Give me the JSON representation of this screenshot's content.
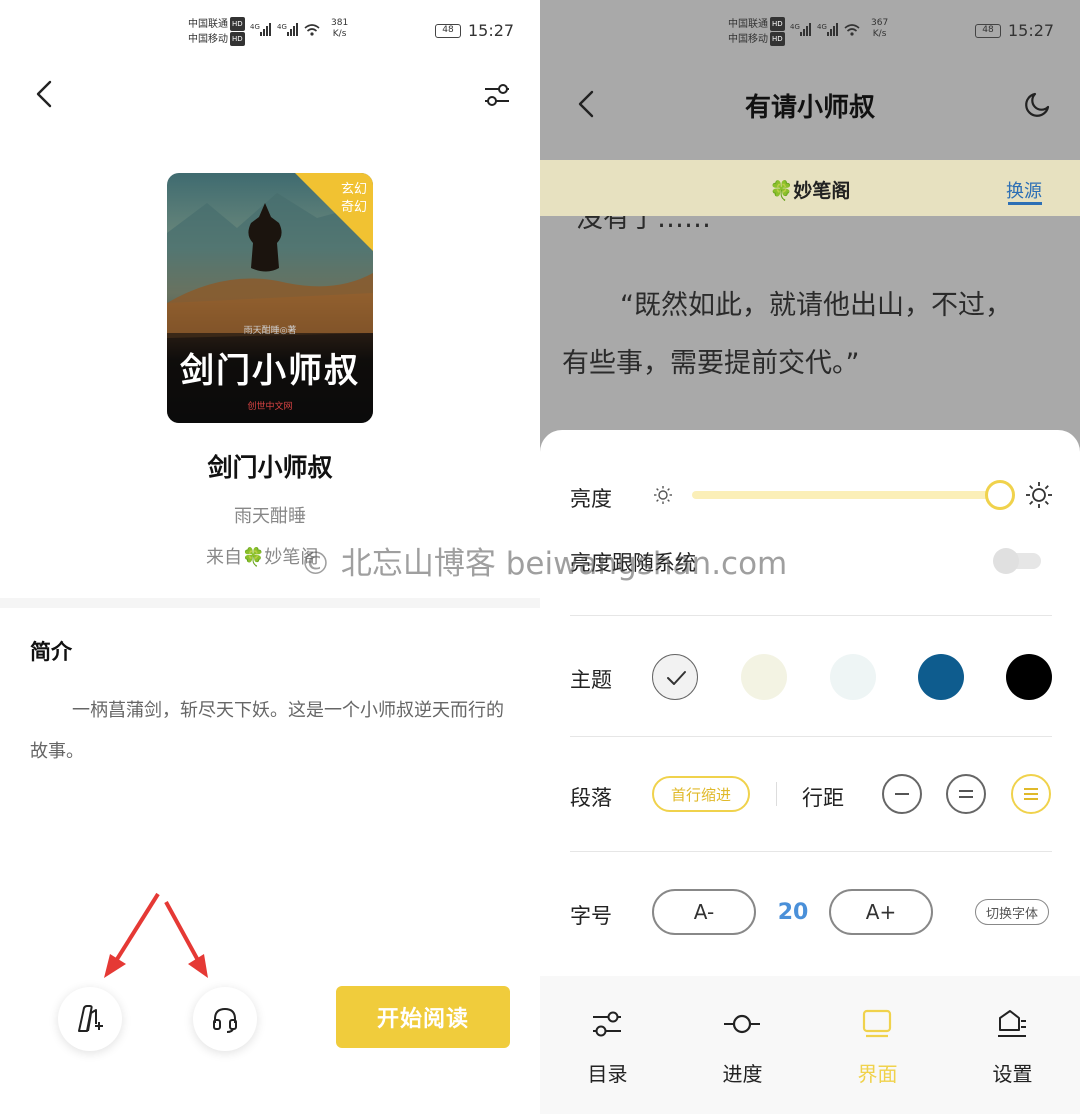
{
  "status_bar": {
    "carrier1": "中国联通",
    "carrier2": "中国移动",
    "hd": "HD",
    "network": "4G",
    "left_speed_value": "381",
    "right_speed_value": "367",
    "speed_unit": "K/s",
    "battery": "48",
    "time": "15:27"
  },
  "book_detail": {
    "cover": {
      "genre_line1": "玄幻",
      "genre_line2": "奇幻",
      "author_line": "雨天酣睡◎著",
      "title_art": "剑门小师叔",
      "publisher": "创世中文网"
    },
    "title": "剑门小师叔",
    "author": "雨天酣睡",
    "source": "来自🍀妙笔阁",
    "intro_heading": "简介",
    "intro_text": "一柄菖蒲剑，斩尽天下妖。这是一个小师叔逆天而行的故事。",
    "start_reading_label": "开始阅读",
    "watermark": "© 北忘山博客 beiwangshan.com",
    "accent_color": "#f0cc3c",
    "arrow_color": "#e53935",
    "icons": [
      "back-icon",
      "settings-sliders-icon",
      "add-to-shelf-icon",
      "headphones-icon"
    ]
  },
  "reader": {
    "chapter_title": "有请小师叔",
    "source_name": "🍀妙笔阁",
    "switch_source_label": "换源",
    "text_line1": "“没有了……",
    "text_line2": "“既然如此，就请他出山，不过，",
    "text_line3": "有些事，需要提前交代。”",
    "panel": {
      "brightness_label": "亮度",
      "brightness_level": 1.0,
      "follow_system_label": "亮度跟随系统",
      "follow_system_enabled": false,
      "theme_label": "主题",
      "theme_colors": [
        "#f2f2f2",
        "#f3f3e3",
        "#eef5f5",
        "#0e5c8e",
        "#000000"
      ],
      "theme_selected": 0,
      "paragraph_label": "段落",
      "indent_label": "首行缩进",
      "line_spacing_label": "行距",
      "font_size_label": "字号",
      "font_decrease_label": "A-",
      "font_size_value": "20",
      "font_increase_label": "A+",
      "switch_font_label": "切换字体",
      "accent_color": "#f0d24c",
      "value_color": "#4a90d9"
    },
    "nav": [
      {
        "label": "目录",
        "icon": "catalog-icon",
        "active": false
      },
      {
        "label": "进度",
        "icon": "progress-icon",
        "active": false
      },
      {
        "label": "界面",
        "icon": "display-icon",
        "active": true
      },
      {
        "label": "设置",
        "icon": "settings-icon",
        "active": false
      }
    ]
  }
}
